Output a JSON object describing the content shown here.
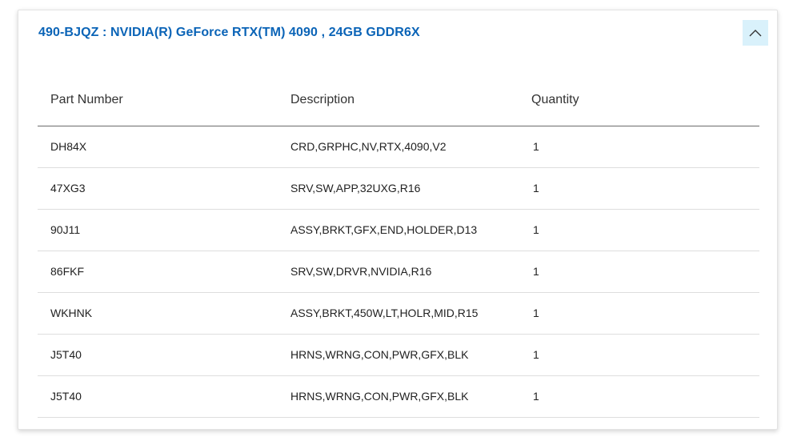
{
  "card": {
    "title": "490-BJQZ : NVIDIA(R) GeForce RTX(TM) 4090 , 24GB GDDR6X",
    "collapse_icon": "chevron-up-icon",
    "accent_color": "#0b64b7",
    "button_bg": "#d9f1fb"
  },
  "table": {
    "headers": {
      "part_number": "Part Number",
      "description": "Description",
      "quantity": "Quantity"
    },
    "rows": [
      {
        "part_number": "DH84X",
        "description": "CRD,GRPHC,NV,RTX,4090,V2",
        "quantity": "1"
      },
      {
        "part_number": "47XG3",
        "description": "SRV,SW,APP,32UXG,R16",
        "quantity": "1"
      },
      {
        "part_number": "90J11",
        "description": "ASSY,BRKT,GFX,END,HOLDER,D13",
        "quantity": "1"
      },
      {
        "part_number": "86FKF",
        "description": "SRV,SW,DRVR,NVIDIA,R16",
        "quantity": "1"
      },
      {
        "part_number": "WKHNK",
        "description": "ASSY,BRKT,450W,LT,HOLR,MID,R15",
        "quantity": "1"
      },
      {
        "part_number": "J5T40",
        "description": "HRNS,WRNG,CON,PWR,GFX,BLK",
        "quantity": "1"
      },
      {
        "part_number": "J5T40",
        "description": "HRNS,WRNG,CON,PWR,GFX,BLK",
        "quantity": "1"
      }
    ]
  }
}
